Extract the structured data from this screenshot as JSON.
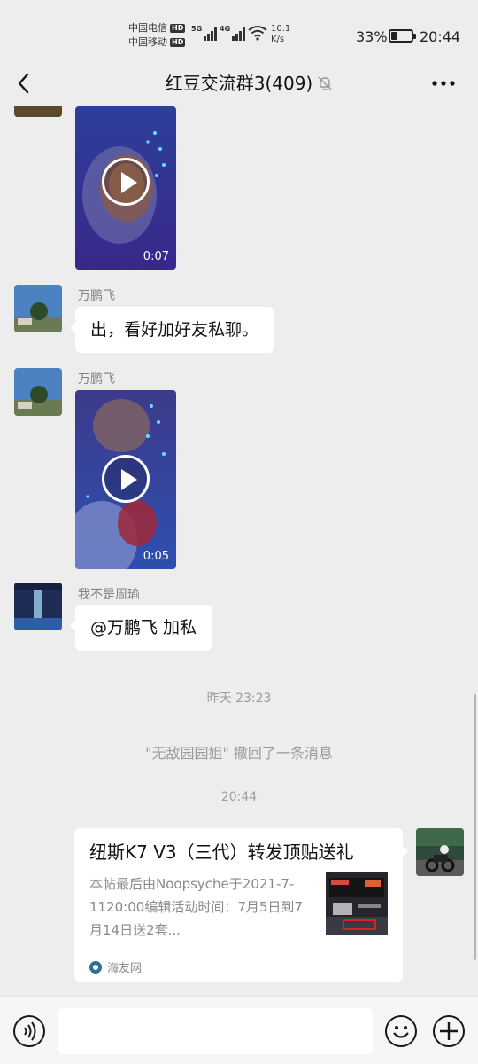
{
  "status_bar": {
    "carrier_1": "中国电信",
    "carrier_2": "中国移动",
    "hd_badge": "HD",
    "network_1": "5G",
    "network_2": "4G",
    "speed_value": "10.1",
    "speed_unit": "K/s",
    "battery_percent": "33%",
    "battery_level": 0.33,
    "time": "20:44"
  },
  "header": {
    "title": "红豆交流群3(409)",
    "back_icon": "chevron-left-icon",
    "mute_icon": "bell-off-icon",
    "more_icon": "ellipsis-icon"
  },
  "messages": {
    "video_1": {
      "duration": "0:07"
    },
    "msg_2": {
      "sender": "万鹏飞",
      "text": "出，看好加好友私聊。"
    },
    "msg_3": {
      "sender": "万鹏飞",
      "duration": "0:05"
    },
    "msg_4": {
      "sender": "我不是周瑜",
      "text": "@万鹏飞  加私"
    },
    "time_1": "昨天 23:23",
    "recall_notice": "\"无敌园园姐\" 撤回了一条消息",
    "time_2": "20:44",
    "link_card": {
      "title": "纽斯K7 V3（三代）转发顶贴送礼",
      "description": "本帖最后由Noopsyche于2021-7-1120:00编辑活动时间：7月5日到7月14日送2套...",
      "source": "海友网",
      "source_icon": "site-logo-icon"
    }
  },
  "input_bar": {
    "voice_icon": "voice-icon",
    "emoji_icon": "emoji-icon",
    "plus_icon": "plus-icon",
    "text_value": ""
  }
}
